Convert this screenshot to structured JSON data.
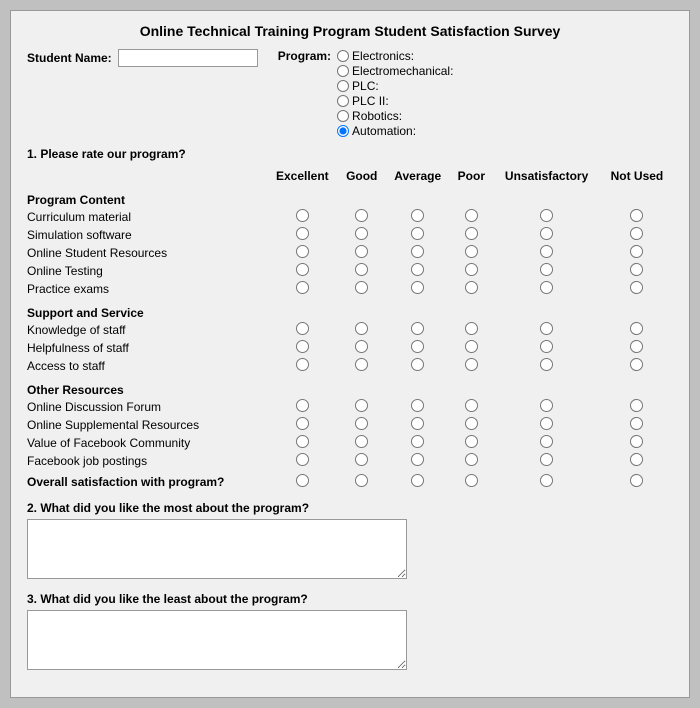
{
  "title": "Online Technical Training Program Student Satisfaction Survey",
  "student_name_label": "Student Name:",
  "program_label": "Program:",
  "programs": [
    {
      "label": "Electronics:",
      "value": "electronics",
      "checked": false
    },
    {
      "label": "Electromechanical:",
      "value": "electromechanical",
      "checked": false
    },
    {
      "label": "PLC:",
      "value": "plc",
      "checked": false
    },
    {
      "label": "PLC II:",
      "value": "plc2",
      "checked": false
    },
    {
      "label": "Robotics:",
      "value": "robotics",
      "checked": false
    },
    {
      "label": "Automation:",
      "value": "automation",
      "checked": true
    }
  ],
  "question1": "1. Please rate our program?",
  "columns": [
    "Excellent",
    "Good",
    "Average",
    "Poor",
    "Unsatisfactory",
    "Not Used"
  ],
  "categories": [
    {
      "name": "Program Content",
      "items": [
        "Curriculum material",
        "Simulation software",
        "Online Student Resources",
        "Online Testing",
        "Practice exams"
      ]
    },
    {
      "name": "Support and Service",
      "items": [
        "Knowledge of staff",
        "Helpfulness of staff",
        "Access to staff"
      ]
    },
    {
      "name": "Other Resources",
      "items": [
        "Online Discussion Forum",
        "Online Supplemental Resources",
        "Value of Facebook Community",
        "Facebook job postings"
      ]
    }
  ],
  "overall_label": "Overall satisfaction with program?",
  "question2_label": "2. What did you like the most about the program?",
  "question3_label": "3. What did you like the least about the program?"
}
